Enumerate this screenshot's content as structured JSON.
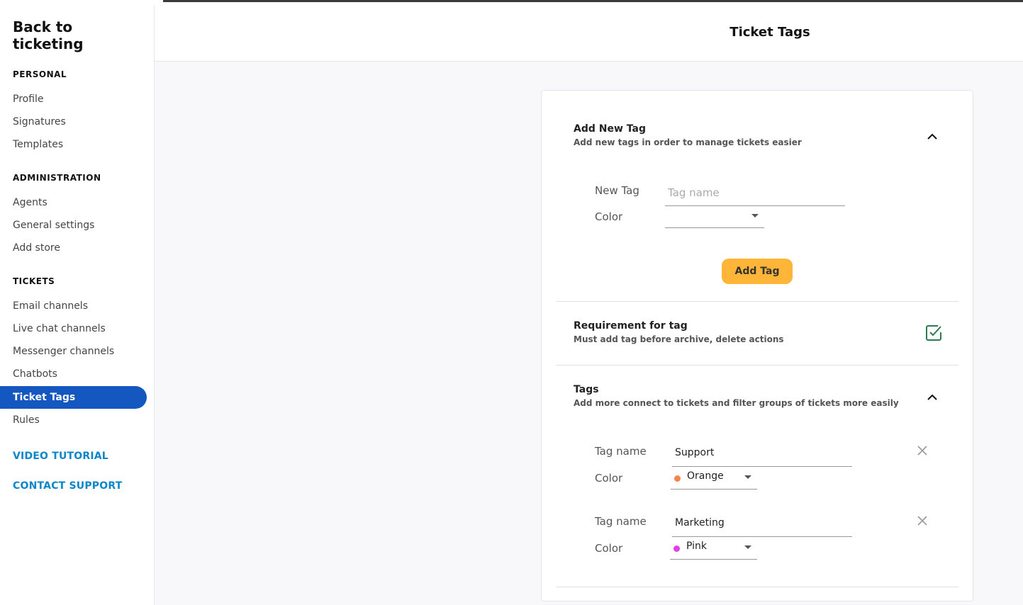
{
  "sidebar": {
    "back_label": "Back to ticketing",
    "sections": [
      {
        "title": "PERSONAL",
        "items": [
          "Profile",
          "Signatures",
          "Templates"
        ]
      },
      {
        "title": "ADMINISTRATION",
        "items": [
          "Agents",
          "General settings",
          "Add store"
        ]
      },
      {
        "title": "TICKETS",
        "items": [
          "Email channels",
          "Live chat channels",
          "Messenger channels",
          "Chatbots",
          "Ticket Tags",
          "Rules"
        ]
      }
    ],
    "active_item": "Ticket Tags",
    "video_tutorial": "VIDEO TUTORIAL",
    "contact_support": "CONTACT SUPPORT"
  },
  "header": {
    "title": "Ticket Tags"
  },
  "add_new_tag": {
    "title": "Add New Tag",
    "subtitle": "Add new tags in order to manage tickets easier",
    "new_tag_label": "New Tag",
    "new_tag_placeholder": "Tag name",
    "new_tag_value": "",
    "color_label": "Color",
    "color_value": "",
    "add_button": "Add Tag"
  },
  "requirement": {
    "title": "Requirement for tag",
    "subtitle": "Must add tag before archive, delete actions",
    "checked": true
  },
  "tags": {
    "title": "Tags",
    "subtitle": "Add more connect to tickets and filter groups of tickets more easily",
    "tag_name_label": "Tag name",
    "color_label": "Color",
    "items": [
      {
        "name": "Support",
        "color_name": "Orange",
        "color_hex": "#f7844d"
      },
      {
        "name": "Marketing",
        "color_name": "Pink",
        "color_hex": "#e040e8"
      }
    ]
  },
  "colors": {
    "accent": "#1557c0",
    "button": "#ffb638",
    "link": "#0a86c9",
    "check": "#2e7d4f"
  }
}
